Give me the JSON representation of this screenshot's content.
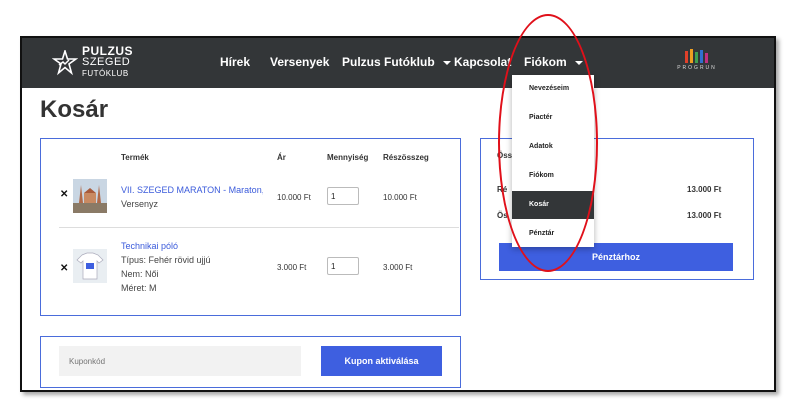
{
  "brand": {
    "line1": "PULZUS",
    "line2": "SZEGED",
    "line3": "FUTÓKLUB"
  },
  "nav": {
    "hirek": "Hírek",
    "versenyek": "Versenyek",
    "pulzus": "Pulzus Futóklub",
    "kapcsolat": "Kapcsolat",
    "fiokom": "Fiókom"
  },
  "partner": {
    "label": "PROGRUN"
  },
  "page": {
    "title": "Kosár"
  },
  "cart": {
    "headers": {
      "product": "Termék",
      "price": "Ár",
      "quantity": "Mennyiség",
      "subtotal": "Részösszeg"
    },
    "items": [
      {
        "name": "VII. SZEGED MARATON - Maraton, 1",
        "meta": [
          "Versenyz"
        ],
        "price": "10.000 Ft",
        "quantity": "1",
        "subtotal": "10.000 Ft"
      },
      {
        "name": "Technikai póló",
        "meta": [
          "Típus: Fehér rövid ujjú",
          "Nem: Női",
          "Méret: M"
        ],
        "price": "3.000 Ft",
        "quantity": "1",
        "subtotal": "3.000 Ft"
      }
    ]
  },
  "coupon": {
    "placeholder": "Kuponkód",
    "button": "Kupon aktiválása"
  },
  "summary": {
    "title_partial": "Öss",
    "row1_label_partial": "Ré",
    "row1_value": "13.000 Ft",
    "row2_label_partial": "Ös",
    "row2_value": "13.000 Ft",
    "checkout_button": "Pénztárhoz"
  },
  "dropdown": {
    "items": [
      "Nevezéseim",
      "Piactér",
      "Adatok",
      "Fiókom",
      "Kosár",
      "Pénztár"
    ],
    "active": "Kosár"
  },
  "colors": {
    "navbar": "#333638",
    "accent": "#3e5fe0",
    "box_border": "#4a6cdb",
    "annotation": "#e0101a"
  }
}
